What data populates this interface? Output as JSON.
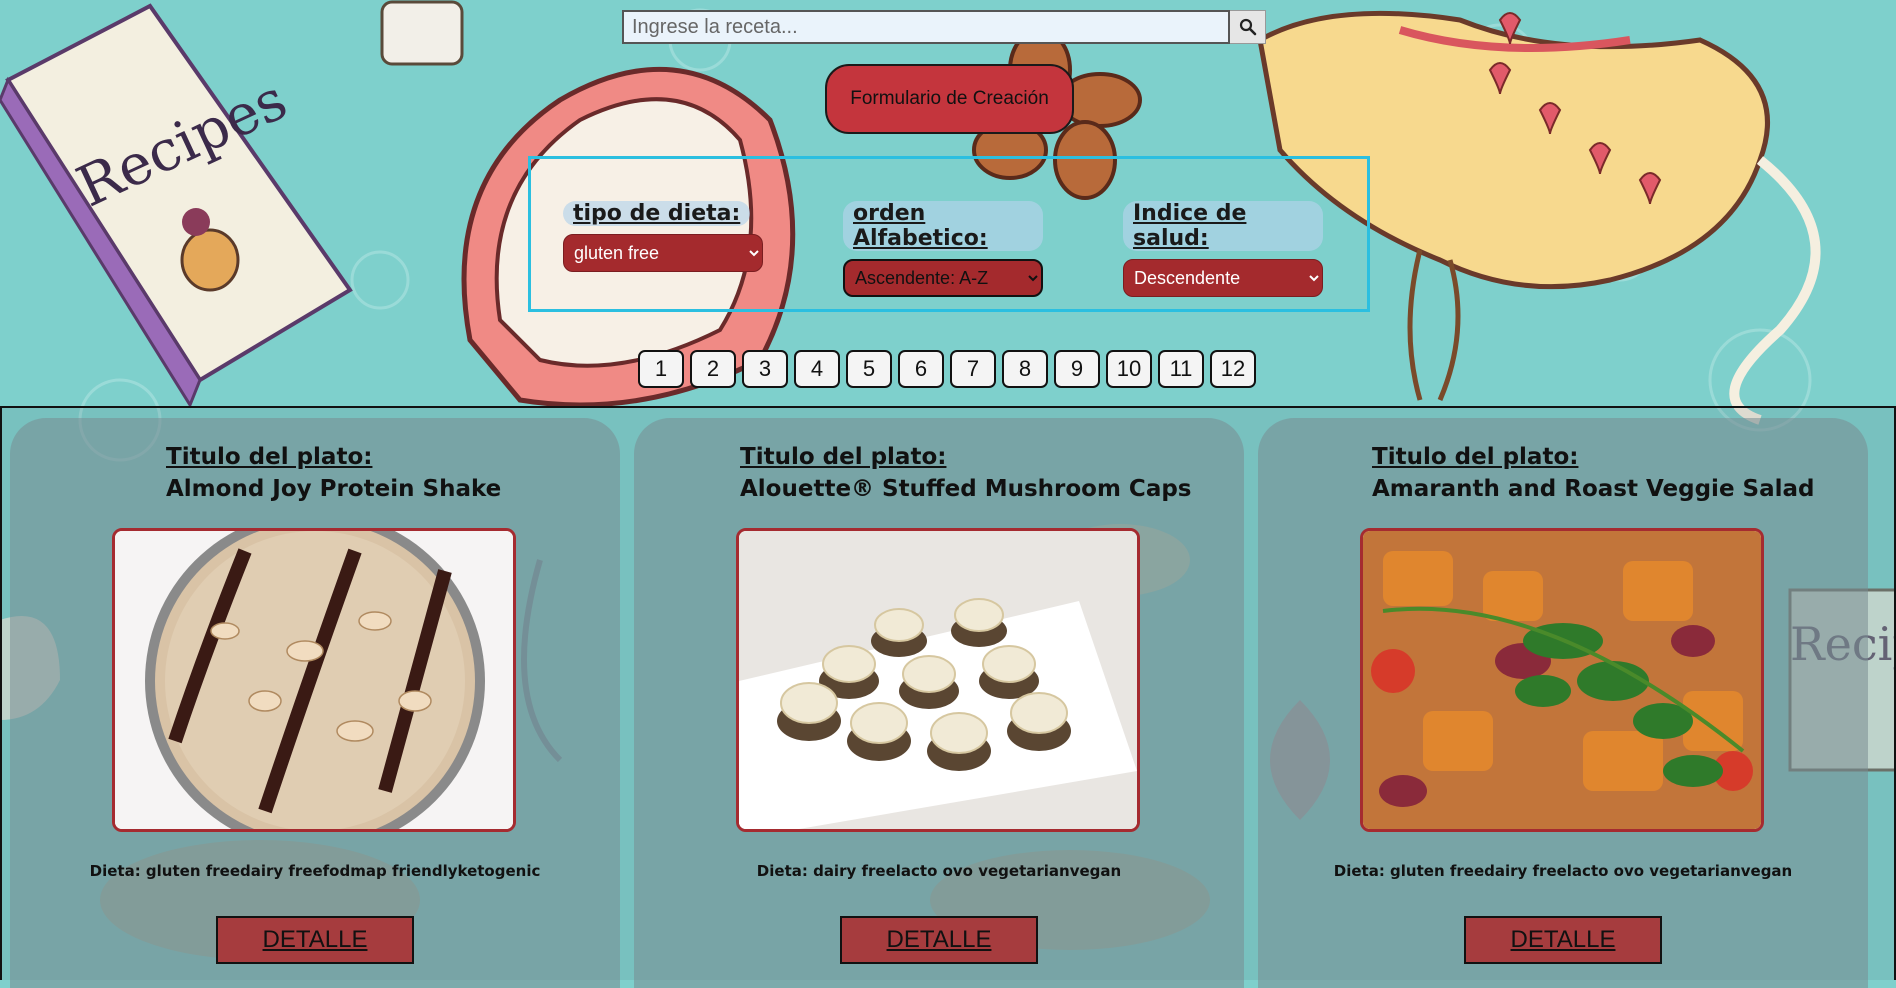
{
  "search": {
    "placeholder": "Ingrese la receta...",
    "value": "",
    "icon": "search-icon"
  },
  "header": {
    "create_button": "Formulario de Creación"
  },
  "filters": [
    {
      "label": "tipo de dieta:",
      "selected": "gluten free"
    },
    {
      "label": "orden Alfabetico:",
      "selected": "Ascendente: A-Z"
    },
    {
      "label": "Indice de salud:",
      "selected": "Descendente"
    }
  ],
  "pagination": {
    "pages": [
      "1",
      "2",
      "3",
      "4",
      "5",
      "6",
      "7",
      "8",
      "9",
      "10",
      "11",
      "12"
    ]
  },
  "cards": [
    {
      "title_label": "Titulo del plato:",
      "title": "Almond Joy Protein Shake",
      "diet": "Dieta: gluten freedairy freefodmap friendlyketogenic",
      "button": "DETALLE"
    },
    {
      "title_label": "Titulo del plato:",
      "title": "Alouette® Stuffed Mushroom Caps",
      "diet": "Dieta: dairy freelacto ovo vegetarianvegan",
      "button": "DETALLE"
    },
    {
      "title_label": "Titulo del plato:",
      "title": "Amaranth and Roast Veggie Salad",
      "diet": "Dieta: gluten freedairy freelacto ovo vegetarianvegan",
      "button": "DETALLE"
    }
  ],
  "colors": {
    "background": "#7ed0cc",
    "accent": "#c4353d",
    "select": "#a42a2d",
    "filter_border": "#2bbfe0"
  }
}
